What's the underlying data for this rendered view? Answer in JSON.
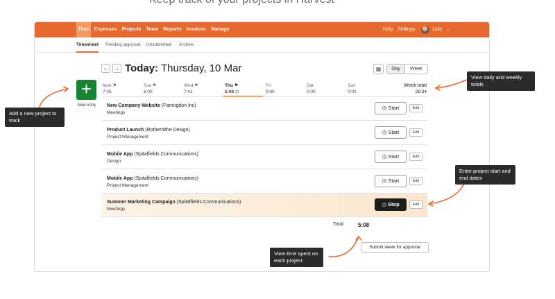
{
  "nav": {
    "items": [
      "Time",
      "Expenses",
      "Projects",
      "Team",
      "Reports",
      "Invoices",
      "Manage"
    ],
    "active": "Time",
    "help": "Help",
    "settings": "Settings",
    "user": "Julie",
    "accent": "#e8692f"
  },
  "subnav": [
    "Timesheet",
    "Pending approval",
    "Unsubmitted",
    "Archive"
  ],
  "header": {
    "today_label": "Today:",
    "date": "Thursday, 10 Mar",
    "view_day": "Day",
    "view_week": "Week"
  },
  "new_entry": {
    "label": "New entry"
  },
  "days": [
    {
      "label": "Mon",
      "time": "7:45"
    },
    {
      "label": "Tue",
      "time": "8:00"
    },
    {
      "label": "Wed",
      "time": "7:41"
    },
    {
      "label": "Thu",
      "time": "5:08"
    },
    {
      "label": "Fri",
      "time": "0:00"
    },
    {
      "label": "Sat",
      "time": "0:00"
    },
    {
      "label": "Sun",
      "time": "0:00"
    }
  ],
  "week_total": {
    "label": "Week total",
    "time": "28:34"
  },
  "entries": [
    {
      "project": "New Company Website",
      "client": "(Farringdon Inc)",
      "task": "Meetings",
      "duration": "0:48",
      "action": "Start",
      "edit": "Edit"
    },
    {
      "project": "Product Launch",
      "client": "(Rotherhithe Design)",
      "task": "Project Management",
      "duration": "1:15",
      "action": "Start",
      "edit": "Edit"
    },
    {
      "project": "Mobile App",
      "client": "(Spitalfields Communications)",
      "task": "Design",
      "duration": "2:21",
      "action": "Start",
      "edit": "Edit"
    },
    {
      "project": "Mobile App",
      "client": "(Spitalfields Communications)",
      "task": "Project Management",
      "duration": "0:42",
      "action": "Start",
      "edit": "Edit"
    },
    {
      "project": "Summer Marketing Campaign",
      "client": "(Spitalfields Communications)",
      "task": "Meetings",
      "duration": "0:02",
      "action": "Stop",
      "edit": "Edit"
    }
  ],
  "total": {
    "label": "Total:",
    "value": "5:08"
  },
  "submit_label": "Submit week for approval",
  "callouts": {
    "new_project": "Add a new project to track",
    "totals": "View daily and weekly totals",
    "dates": "Enter project start and end dates",
    "time_spent": "View time spent on each project"
  }
}
